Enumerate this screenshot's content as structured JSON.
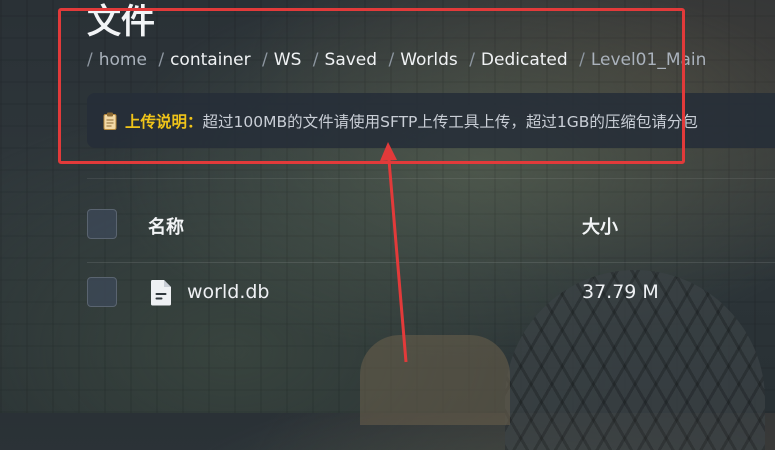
{
  "page": {
    "title": "文件"
  },
  "breadcrumb": {
    "separator": "/",
    "items": [
      "home",
      "container",
      "WS",
      "Saved",
      "Worlds",
      "Dedicated"
    ],
    "current": "Level01_Main"
  },
  "notice": {
    "icon": "clipboard-icon",
    "label": "上传说明：",
    "text": "超过100MB的文件请使用SFTP上传工具上传，超过1GB的压缩包请分包"
  },
  "table": {
    "columns": {
      "name": "名称",
      "size": "大小"
    },
    "rows": [
      {
        "icon": "file-icon",
        "name": "world.db",
        "size": "37.79 M"
      }
    ]
  },
  "annotation": {
    "color": "#e23a3a"
  },
  "colors": {
    "notice_label": "#f0c419",
    "background": "#2b3337"
  }
}
